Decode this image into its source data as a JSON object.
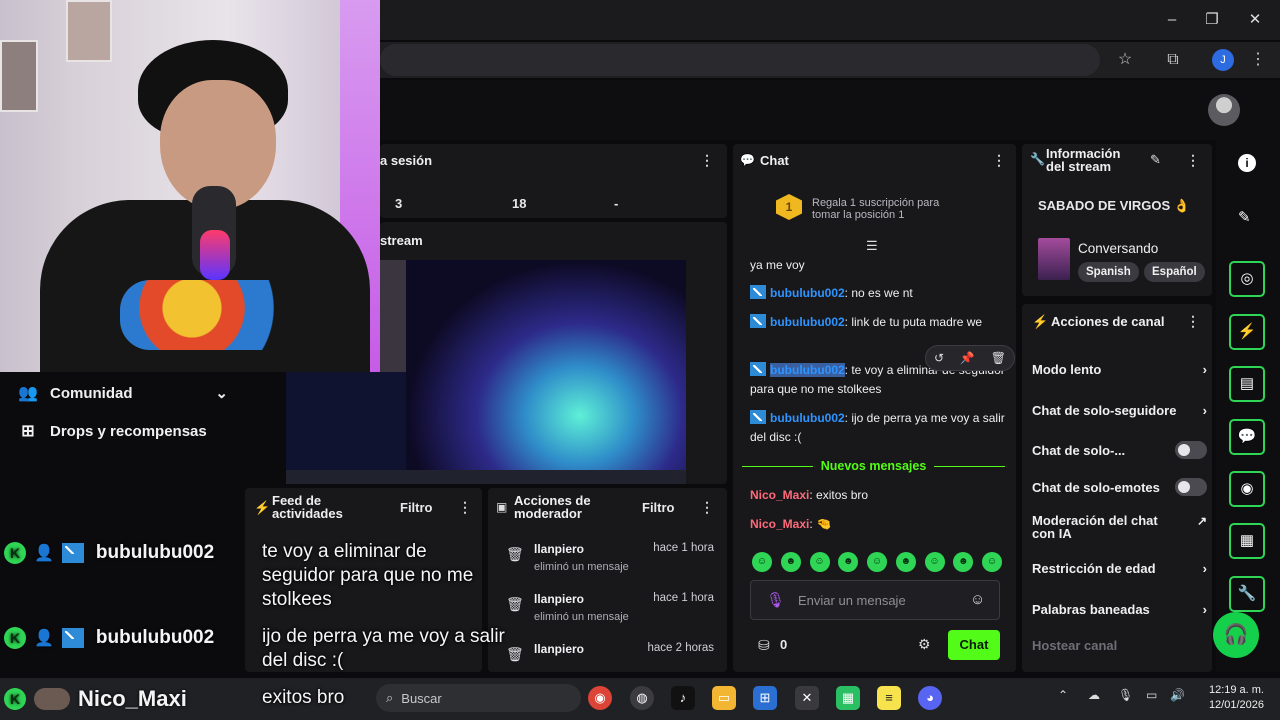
{
  "colors": {
    "accent": "#53fc18",
    "kick_blue": "#2e94ff",
    "username_red": "#ff6a7a",
    "panel": "#18181b"
  },
  "browser": {
    "profile_initial": "J"
  },
  "left_nav": [
    {
      "label": "Comunidad",
      "icon": "users-icon"
    },
    {
      "label": "Drops y recompensas",
      "icon": "gift-icon"
    }
  ],
  "stats": {
    "title": "a sesión",
    "values": [
      "3",
      "18",
      "-"
    ]
  },
  "stream_preview": {
    "title": "stream"
  },
  "activity": {
    "title": "Feed de actividades",
    "filter": "Filtro"
  },
  "mod_actions": {
    "title": "Acciones de moderador",
    "filter": "Filtro",
    "rows": [
      {
        "name": "llanpiero",
        "desc": "eliminó un mensaje",
        "time": "hace 1 hora"
      },
      {
        "name": "llanpiero",
        "desc": "eliminó un mensaje",
        "time": "hace 1 hora"
      },
      {
        "name": "llanpiero",
        "desc": "",
        "time": "hace 2 horas"
      }
    ]
  },
  "chat": {
    "title": "Chat",
    "sub_promo": {
      "rank": "1",
      "text": "Regala 1 suscripción para tomar la posición 1"
    },
    "messages": [
      {
        "user": "",
        "text": "ya me voy"
      },
      {
        "user": "bubulubu002",
        "text": ": no es we nt"
      },
      {
        "user": "bubulubu002",
        "text": ": link de tu puta madre we"
      },
      {
        "user": "bubulubu002",
        "text": ": te voy a eliminar de seguidor para que no me stolkees"
      },
      {
        "user": "bubulubu002",
        "text": ": ijo de perra ya me voy a salir del disc :("
      }
    ],
    "new_messages_label": "Nuevos mensajes",
    "new_messages": [
      {
        "user": "Nico_Maxi",
        "text": ": exitos bro"
      },
      {
        "user": "Nico_Maxi",
        "text": ":"
      }
    ],
    "input_placeholder": "Enviar un mensaje",
    "points": "0",
    "send_label": "Chat"
  },
  "stream_info": {
    "title": "Información del stream",
    "stream_title": "SABADO DE VIRGOS 👌",
    "category": "Conversando",
    "tags": [
      "Spanish",
      "Español"
    ]
  },
  "channel_actions": {
    "title": "Acciones de canal",
    "items": [
      {
        "label": "Modo lento",
        "control": "chevron"
      },
      {
        "label": "Chat de solo-seguidore",
        "control": "chevron"
      },
      {
        "label": "Chat de solo-...",
        "control": "toggle"
      },
      {
        "label": "Chat de solo-emotes",
        "control": "toggle"
      },
      {
        "label": "Moderación del chat con IA",
        "control": "external"
      },
      {
        "label": "Restricción de edad",
        "control": "chevron"
      },
      {
        "label": "Palabras baneadas",
        "control": "chevron"
      },
      {
        "label": "Hostear canal",
        "control": "none"
      }
    ]
  },
  "overlay": {
    "rows": [
      {
        "user": "bubulubu002"
      },
      {
        "user": "bubulubu002"
      },
      {
        "user": "Nico_Maxi"
      }
    ],
    "messages": [
      "te voy a eliminar de seguidor para que no me stolkees",
      "ijo de perra ya me voy a salir del disc :(",
      "exitos bro"
    ]
  },
  "taskbar": {
    "search_placeholder": "Buscar",
    "time": "12:19 a. m.",
    "date": "12/01/2026"
  }
}
